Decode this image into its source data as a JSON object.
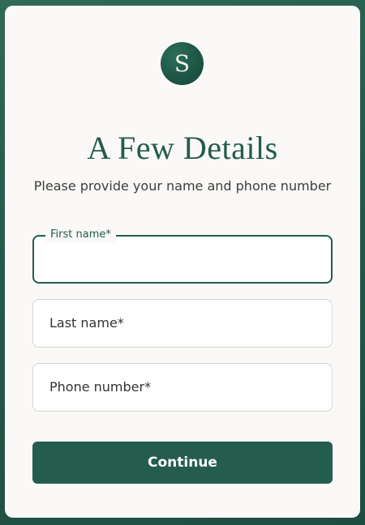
{
  "logo": {
    "letter": "S"
  },
  "header": {
    "title": "A Few Details",
    "subtitle": "Please provide your name and phone number"
  },
  "form": {
    "first_name": {
      "label": "First name*",
      "value": "",
      "focused": true
    },
    "last_name": {
      "label": "Last name*",
      "value": ""
    },
    "phone": {
      "label": "Phone number*",
      "value": ""
    },
    "continue_label": "Continue"
  },
  "colors": {
    "accent": "#245c4d",
    "background": "#24584a",
    "card": "#faf9f7"
  }
}
